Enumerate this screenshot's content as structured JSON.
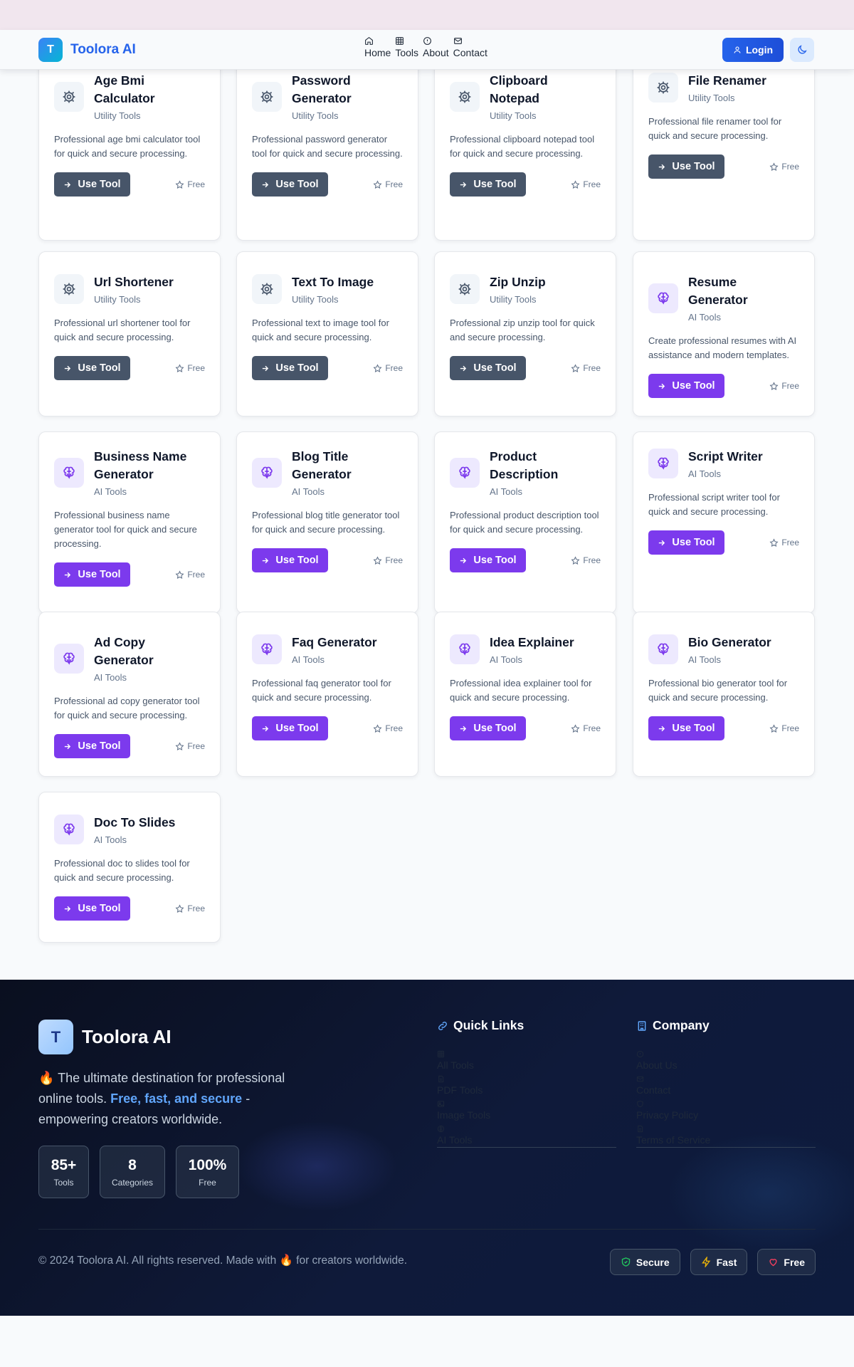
{
  "navbar": {
    "logo_letter": "T",
    "brand": "Toolora AI",
    "links": [
      {
        "label": "Home",
        "icon": "home-icon"
      },
      {
        "label": "Tools",
        "icon": "grid-icon"
      },
      {
        "label": "About",
        "icon": "info-icon"
      },
      {
        "label": "Contact",
        "icon": "mail-icon"
      }
    ],
    "login_label": "Login",
    "theme_icon": "moon-icon"
  },
  "colors": {
    "brand": "#2563eb",
    "util_button": "#475569",
    "ai_button": "#7c3aed"
  },
  "tools": [
    {
      "title": "Age Bmi Calculator",
      "category": "Utility Tools",
      "kind": "util",
      "description": "Professional age bmi calculator tool for quick and secure processing.",
      "button": "Use Tool",
      "badge": "Free"
    },
    {
      "title": "Password Generator",
      "category": "Utility Tools",
      "kind": "util",
      "description": "Professional password generator tool for quick and secure processing.",
      "button": "Use Tool",
      "badge": "Free"
    },
    {
      "title": "Clipboard Notepad",
      "category": "Utility Tools",
      "kind": "util",
      "description": "Professional clipboard notepad tool for quick and secure processing.",
      "button": "Use Tool",
      "badge": "Free"
    },
    {
      "title": "File Renamer",
      "category": "Utility Tools",
      "kind": "util",
      "description": "Professional file renamer tool for quick and secure processing.",
      "button": "Use Tool",
      "badge": "Free"
    },
    {
      "title": "Url Shortener",
      "category": "Utility Tools",
      "kind": "util",
      "description": "Professional url shortener tool for quick and secure processing.",
      "button": "Use Tool",
      "badge": "Free"
    },
    {
      "title": "Text To Image",
      "category": "Utility Tools",
      "kind": "util",
      "description": "Professional text to image tool for quick and secure processing.",
      "button": "Use Tool",
      "badge": "Free"
    },
    {
      "title": "Zip Unzip",
      "category": "Utility Tools",
      "kind": "util",
      "description": "Professional zip unzip tool for quick and secure processing.",
      "button": "Use Tool",
      "badge": "Free"
    },
    {
      "title": "Resume Generator",
      "category": "AI Tools",
      "kind": "ai",
      "description": "Create professional resumes with AI assistance and modern templates.",
      "button": "Use Tool",
      "badge": "Free"
    },
    {
      "title": "Business Name Generator",
      "category": "AI Tools",
      "kind": "ai",
      "description": "Professional business name generator tool for quick and secure processing.",
      "button": "Use Tool",
      "badge": "Free"
    },
    {
      "title": "Blog Title Generator",
      "category": "AI Tools",
      "kind": "ai",
      "description": "Professional blog title generator tool for quick and secure processing.",
      "button": "Use Tool",
      "badge": "Free"
    },
    {
      "title": "Product Description",
      "category": "AI Tools",
      "kind": "ai",
      "description": "Professional product description tool for quick and secure processing.",
      "button": "Use Tool",
      "badge": "Free"
    },
    {
      "title": "Script Writer",
      "category": "AI Tools",
      "kind": "ai",
      "description": "Professional script writer tool for quick and secure processing.",
      "button": "Use Tool",
      "badge": "Free"
    },
    {
      "title": "Ad Copy Generator",
      "category": "AI Tools",
      "kind": "ai",
      "description": "Professional ad copy generator tool for quick and secure processing.",
      "button": "Use Tool",
      "badge": "Free"
    },
    {
      "title": "Faq Generator",
      "category": "AI Tools",
      "kind": "ai",
      "description": "Professional faq generator tool for quick and secure processing.",
      "button": "Use Tool",
      "badge": "Free"
    },
    {
      "title": "Idea Explainer",
      "category": "AI Tools",
      "kind": "ai",
      "description": "Professional idea explainer tool for quick and secure processing.",
      "button": "Use Tool",
      "badge": "Free"
    },
    {
      "title": "Bio Generator",
      "category": "AI Tools",
      "kind": "ai",
      "description": "Professional bio generator tool for quick and secure processing.",
      "button": "Use Tool",
      "badge": "Free"
    },
    {
      "title": "Doc To Slides",
      "category": "AI Tools",
      "kind": "ai",
      "description": "Professional doc to slides tool for quick and secure processing.",
      "button": "Use Tool",
      "badge": "Free"
    }
  ],
  "footer": {
    "logo_letter": "T",
    "brand": "Toolora AI",
    "tagline_emoji": "🔥",
    "tagline_pre": "The ultimate destination for professional online tools.",
    "tagline_highlight": "Free, fast, and secure",
    "tagline_post": "- empowering creators worldwide.",
    "stats": [
      {
        "value": "85+",
        "label": "Tools"
      },
      {
        "value": "8",
        "label": "Categories"
      },
      {
        "value": "100%",
        "label": "Free"
      }
    ],
    "quick_links": {
      "heading": "Quick Links",
      "items": [
        {
          "label": "All Tools",
          "icon": "grid-icon"
        },
        {
          "label": "PDF Tools",
          "icon": "file-icon"
        },
        {
          "label": "Image Tools",
          "icon": "image-icon"
        },
        {
          "label": "AI Tools",
          "icon": "brain-icon"
        }
      ]
    },
    "company": {
      "heading": "Company",
      "items": [
        {
          "label": "About Us",
          "icon": "info-icon"
        },
        {
          "label": "Contact",
          "icon": "mail-icon"
        },
        {
          "label": "Privacy Policy",
          "icon": "shield-icon"
        },
        {
          "label": "Terms of Service",
          "icon": "file-icon"
        }
      ]
    },
    "copyright": "© 2024 Toolora AI. All rights reserved. Made with 🔥 for creators worldwide.",
    "badges": [
      {
        "label": "Secure",
        "icon": "shield-check-icon"
      },
      {
        "label": "Fast",
        "icon": "bolt-icon"
      },
      {
        "label": "Free",
        "icon": "heart-icon"
      }
    ]
  }
}
